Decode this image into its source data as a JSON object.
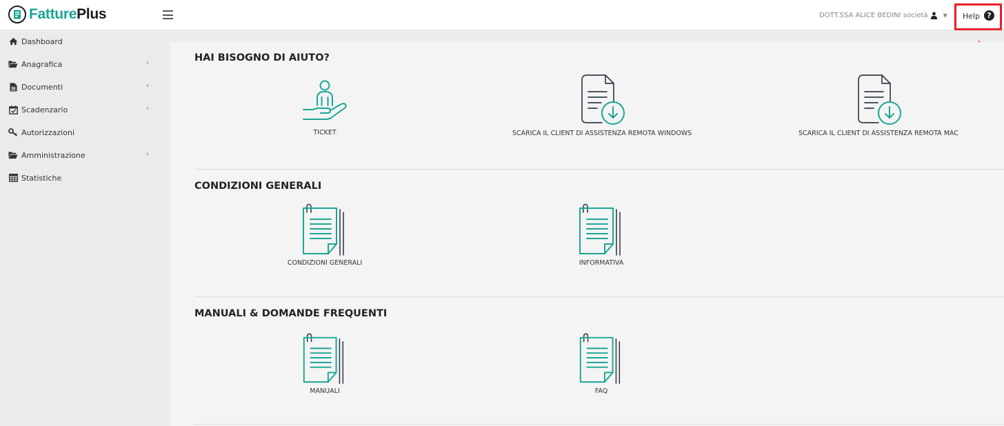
{
  "app": {
    "brand_part1": "Fatture",
    "brand_part2": "Plus"
  },
  "header": {
    "user_name": "DOTT.SSA ALICE BEDINI società",
    "help_label": "Help",
    "help_icon": "?"
  },
  "sidebar": {
    "items": [
      {
        "label": "Dashboard",
        "icon": "home-icon"
      },
      {
        "label": "Anagrafica",
        "icon": "folder-open-icon"
      },
      {
        "label": "Documenti",
        "icon": "document-icon"
      },
      {
        "label": "Scadenzario",
        "icon": "calendar-check-icon"
      },
      {
        "label": "Autorizzazioni",
        "icon": "key-icon"
      },
      {
        "label": "Amministrazione",
        "icon": "folder-open-icon"
      },
      {
        "label": "Statistiche",
        "icon": "table-icon"
      }
    ],
    "chevron": "‹"
  },
  "sections": [
    {
      "title": "HAI BISOGNO DI AIUTO?",
      "tiles": [
        {
          "label": "TICKET",
          "icon": "hand-person-icon"
        },
        {
          "label": "SCARICA IL CLIENT DI ASSISTENZA REMOTA WINDOWS",
          "icon": "document-download-icon"
        },
        {
          "label": "SCARICA IL CLIENT DI ASSISTENZA REMOTA MAC",
          "icon": "document-download-icon"
        }
      ]
    },
    {
      "title": "CONDIZIONI GENERALI",
      "tiles": [
        {
          "label": "CONDIZIONI GENERALI",
          "icon": "clipped-document-icon"
        },
        {
          "label": "INFORMATIVA",
          "icon": "clipped-document-icon"
        }
      ]
    },
    {
      "title": "MANUALI & DOMANDE FREQUENTI",
      "tiles": [
        {
          "label": "MANUALI",
          "icon": "clipped-document-icon"
        },
        {
          "label": "FAQ",
          "icon": "clipped-document-icon"
        }
      ]
    }
  ],
  "colors": {
    "accent": "#1aa595",
    "annotation": "#e8202a"
  }
}
